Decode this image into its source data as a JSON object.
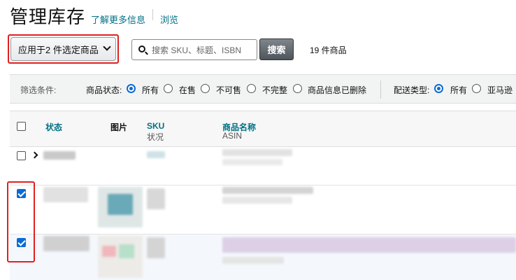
{
  "header": {
    "title": "管理库存",
    "learn_more": "了解更多信息",
    "browse": "浏览"
  },
  "toolbar": {
    "bulk_action_label": "应用于2 件选定商品",
    "search_placeholder": "搜索 SKU、标题、ISBN",
    "search_button": "搜索",
    "result_count": "19 件商品"
  },
  "filters": {
    "label": "筛选条件:",
    "status_label": "商品状态:",
    "status_options": [
      "所有",
      "在售",
      "不可售",
      "不完整",
      "商品信息已删除"
    ],
    "status_selected": "所有",
    "fulfillment_label": "配送类型:",
    "fulfillment_options": [
      "所有",
      "亚马逊"
    ],
    "fulfillment_selected": "所有"
  },
  "table": {
    "columns": {
      "status": "状态",
      "image": "图片",
      "sku": "SKU",
      "sku_sub": "状况",
      "name": "商品名称",
      "name_sub": "ASIN"
    },
    "rows": [
      {
        "checked": false,
        "expandable": true
      },
      {
        "checked": true,
        "expandable": false
      },
      {
        "checked": true,
        "expandable": false
      }
    ]
  },
  "colors": {
    "accent": "#007185",
    "checkbox": "#0a6bd6",
    "highlight": "#e02020",
    "filter_bg": "#f2f4f4"
  }
}
